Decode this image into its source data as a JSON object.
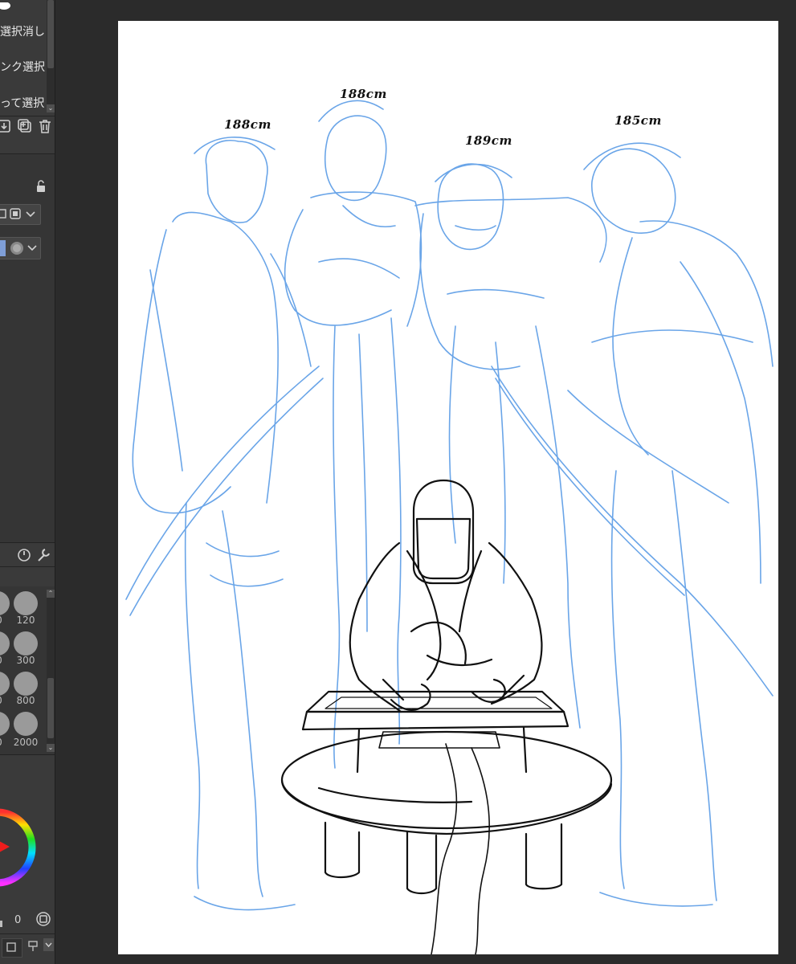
{
  "selection_menu": {
    "items": [
      {
        "label": "選択消し"
      },
      {
        "label": "ンク選択"
      },
      {
        "label": "って選択"
      }
    ]
  },
  "layer_actions": {
    "icons": [
      "import-icon",
      "new-layer-icon",
      "delete-icon"
    ]
  },
  "brush_sizes": {
    "rows": [
      {
        "left": "0",
        "right": "120"
      },
      {
        "left": "0",
        "right": "300"
      },
      {
        "left": "0",
        "right": "800"
      },
      {
        "left": "0",
        "right": "2000"
      }
    ]
  },
  "color_wheel": {
    "value": "0"
  },
  "canvas": {
    "height_labels": [
      "188cm",
      "188cm",
      "189cm",
      "185cm"
    ],
    "colors": {
      "sketch_blue": "#6aa5e8",
      "ink": "#111111",
      "background": "#ffffff"
    }
  }
}
